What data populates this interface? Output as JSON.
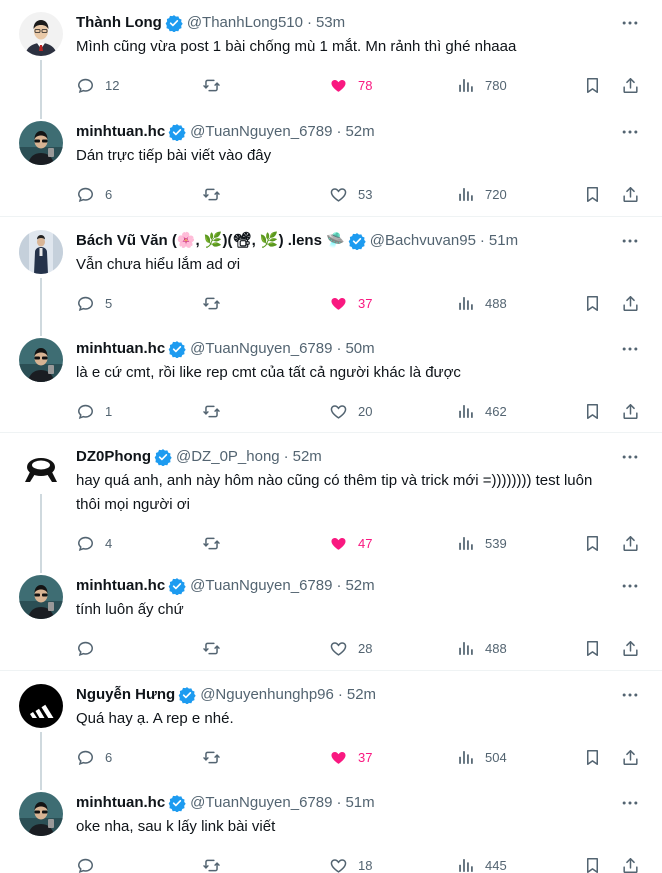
{
  "colors": {
    "text": "#0f1419",
    "secondary": "#536471",
    "verified_blue": "#1d9bf0",
    "like_pink": "#f91880",
    "thread_line": "#cfd9de",
    "divider": "#eff3f4"
  },
  "icons": {
    "reply": "reply-icon",
    "retweet": "retweet-icon",
    "like": "heart-icon",
    "views": "views-chart-icon",
    "bookmark": "bookmark-icon",
    "share": "share-icon",
    "more": "more-horizontal-icon",
    "verified": "verified-badge-icon"
  },
  "threads": [
    {
      "parent": {
        "name": "Thành Long",
        "handle": "@ThanhLong510",
        "time": "53m",
        "text": "Mình cũng vừa post 1 bài chống mù 1 mắt. Mn rảnh thì ghé nhaaa",
        "replies": "12",
        "retweets": "",
        "likes": "78",
        "liked": true,
        "views": "780",
        "avatar": "man-in-suit"
      },
      "reply": {
        "name": "minhtuan.hc",
        "handle": "@TuanNguyen_6789",
        "time": "52m",
        "text": "Dán trực tiếp bài viết vào đây",
        "replies": "6",
        "retweets": "",
        "likes": "53",
        "liked": false,
        "views": "720",
        "avatar": "minhtuan"
      }
    },
    {
      "parent": {
        "name": "Bách Vũ Văn (🌸, 🌿)(📽, 🌿) .lens 🛸",
        "handle": "@Bachvuvan95",
        "time": "51m",
        "text": "Vẫn chưa hiểu lắm ad ơi",
        "replies": "5",
        "retweets": "",
        "likes": "37",
        "liked": true,
        "views": "488",
        "avatar": "standing-man"
      },
      "reply": {
        "name": "minhtuan.hc",
        "handle": "@TuanNguyen_6789",
        "time": "50m",
        "text": "là e cứ cmt, rồi like rep cmt của tất cả người khác là được",
        "replies": "1",
        "retweets": "",
        "likes": "20",
        "liked": false,
        "views": "462",
        "avatar": "minhtuan"
      }
    },
    {
      "parent": {
        "name": "DZ0Phong",
        "handle": "@DZ_0P_hong",
        "time": "52m",
        "text": "hay quá anh, anh này hôm nào cũng có thêm tip và trick mới =)))))))) test luôn thôi mọi người ơi",
        "replies": "4",
        "retweets": "",
        "likes": "47",
        "liked": true,
        "views": "539",
        "avatar": "black-logo"
      },
      "reply": {
        "name": "minhtuan.hc",
        "handle": "@TuanNguyen_6789",
        "time": "52m",
        "text": "tính luôn ấy chứ",
        "replies": "",
        "retweets": "",
        "likes": "28",
        "liked": false,
        "views": "488",
        "avatar": "minhtuan"
      }
    },
    {
      "parent": {
        "name": "Nguyễn Hưng",
        "handle": "@Nguyenhunghp96",
        "time": "52m",
        "text": "Quá hay ạ. A rep e nhé.",
        "replies": "6",
        "retweets": "",
        "likes": "37",
        "liked": true,
        "views": "504",
        "avatar": "adidas-logo"
      },
      "reply": {
        "name": "minhtuan.hc",
        "handle": "@TuanNguyen_6789",
        "time": "51m",
        "text": "oke nha, sau k lấy link bài viết",
        "replies": "",
        "retweets": "",
        "likes": "18",
        "liked": false,
        "views": "445",
        "avatar": "minhtuan"
      }
    }
  ]
}
